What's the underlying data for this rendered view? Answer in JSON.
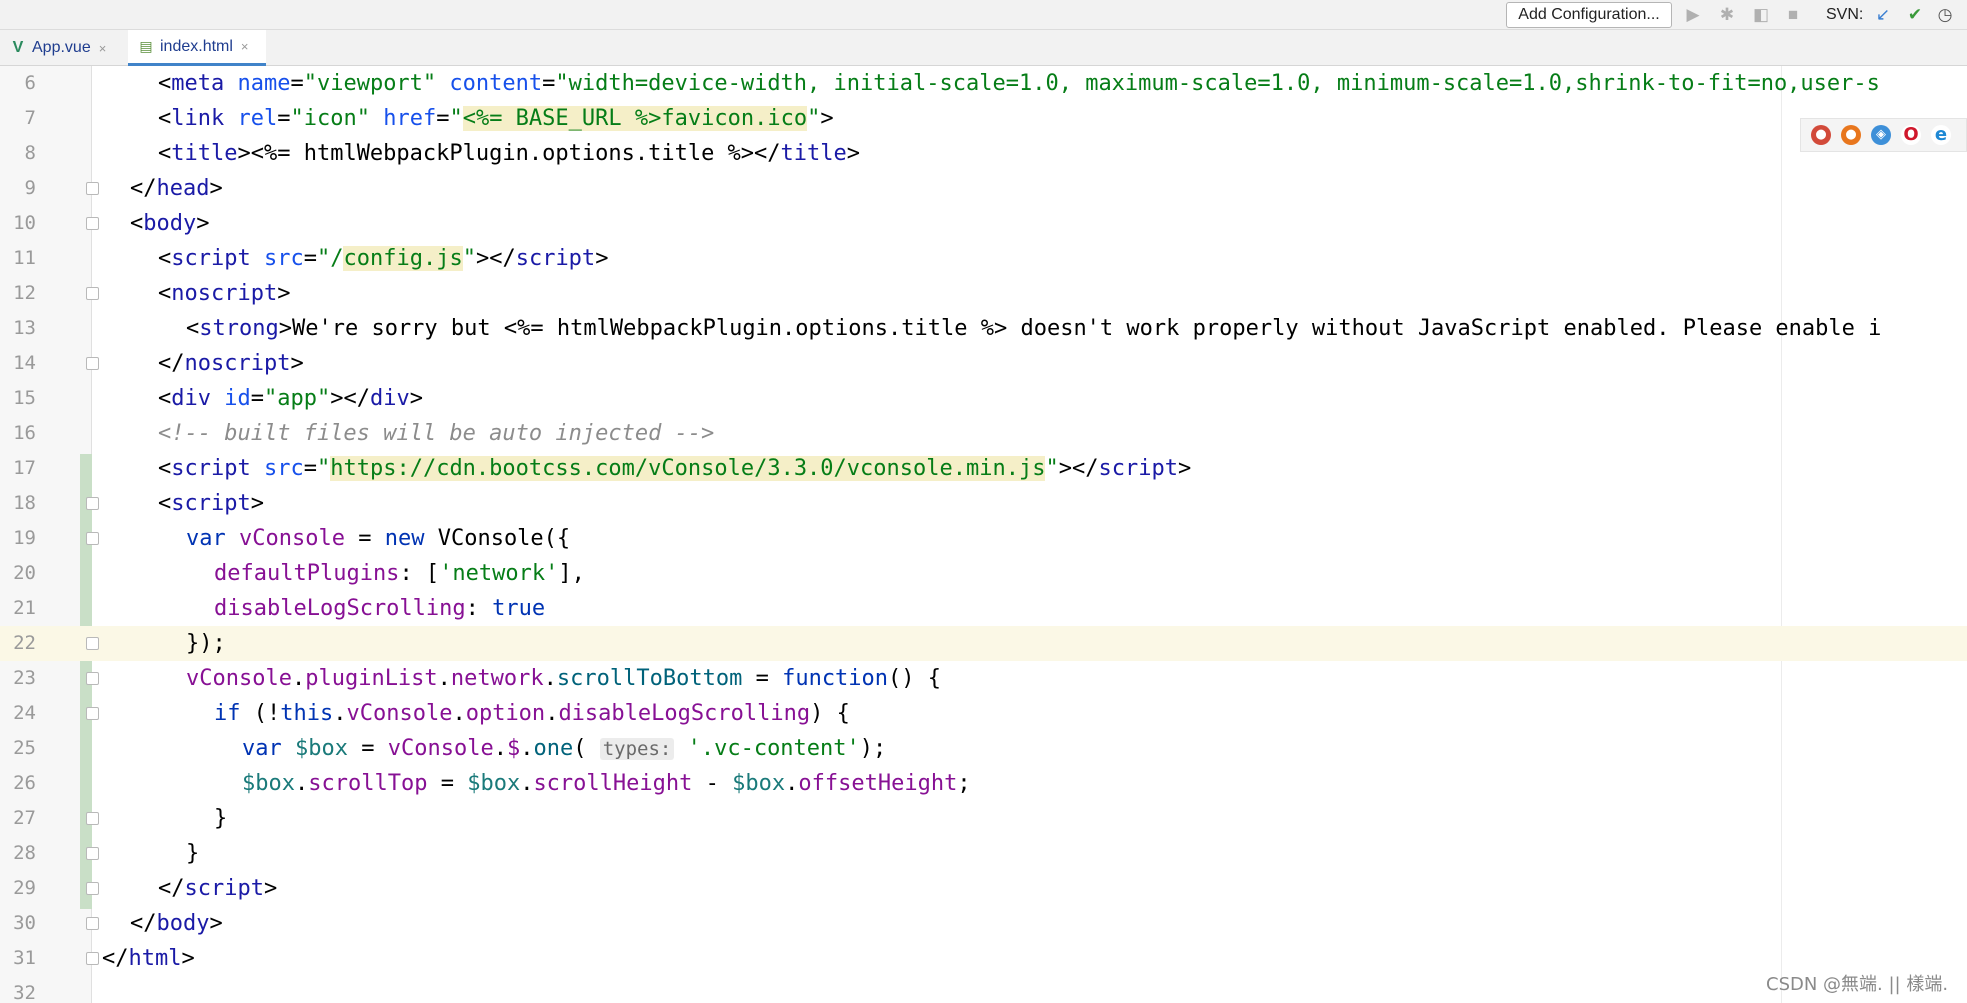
{
  "toolbar": {
    "add_config_label": "Add Configuration...",
    "svn_label": "SVN:",
    "icons": [
      "run-icon",
      "debug-icon",
      "coverage-icon",
      "stop-icon",
      "svn-update-icon",
      "svn-commit-icon",
      "history-icon"
    ]
  },
  "tabs": [
    {
      "label": "App.vue",
      "icon": "vue-icon",
      "close": "×"
    },
    {
      "label": "index.html",
      "icon": "html-file-icon",
      "close": "×"
    }
  ],
  "active_tab": "index.html",
  "editor": {
    "current_line": 22,
    "lines": [
      {
        "n": "6"
      },
      {
        "n": "7"
      },
      {
        "n": "8"
      },
      {
        "n": "9"
      },
      {
        "n": "10"
      },
      {
        "n": "11"
      },
      {
        "n": "12"
      },
      {
        "n": "13"
      },
      {
        "n": "14"
      },
      {
        "n": "15"
      },
      {
        "n": "16"
      },
      {
        "n": "17"
      },
      {
        "n": "18"
      },
      {
        "n": "19"
      },
      {
        "n": "20"
      },
      {
        "n": "21"
      },
      {
        "n": "22"
      },
      {
        "n": "23"
      },
      {
        "n": "24"
      },
      {
        "n": "25"
      },
      {
        "n": "26"
      },
      {
        "n": "27"
      },
      {
        "n": "28"
      },
      {
        "n": "29"
      },
      {
        "n": "30"
      },
      {
        "n": "31"
      },
      {
        "n": "32"
      }
    ],
    "param_hint": "types:"
  },
  "browsers": [
    "chrome-icon",
    "firefox-icon",
    "safari-icon",
    "opera-icon",
    "ie-icon"
  ],
  "watermark": "CSDN @無端. || 樣端.",
  "colors": {
    "tag": "#1a1aa6",
    "attribute": "#1750eb",
    "string": "#067d17",
    "keyword": "#0033b3",
    "property": "#871094",
    "comment": "#8c8c8c",
    "current_line_bg": "#fbf8e6",
    "change_marker": "#c9dfc7"
  }
}
